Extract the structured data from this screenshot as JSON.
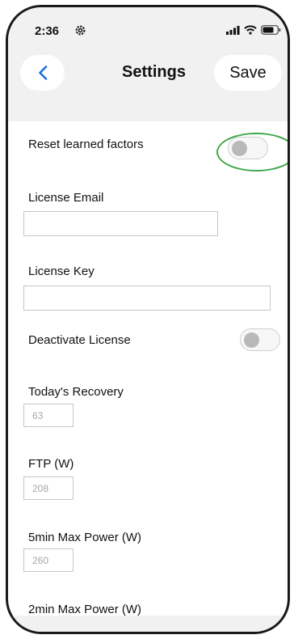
{
  "status_bar": {
    "time": "2:36",
    "icons": [
      "gear-icon",
      "signal-icon",
      "wifi-icon",
      "battery-icon"
    ]
  },
  "header": {
    "back_icon": "chevron-left-icon",
    "title": "Settings",
    "save_label": "Save"
  },
  "settings": {
    "reset_learned_factors": {
      "label": "Reset learned factors",
      "enabled": false
    },
    "license_email": {
      "label": "License Email",
      "value": ""
    },
    "license_key": {
      "label": "License Key",
      "value": ""
    },
    "deactivate_license": {
      "label": "Deactivate License",
      "enabled": false
    },
    "todays_recovery": {
      "label": "Today's Recovery",
      "placeholder": "63"
    },
    "ftp": {
      "label": "FTP (W)",
      "placeholder": "208"
    },
    "max_power_5min": {
      "label": "5min Max Power (W)",
      "placeholder": "260"
    },
    "max_power_2min": {
      "label": "2min Max Power (W)"
    }
  },
  "colors": {
    "header_bg": "#f1f1f2",
    "highlight_ring": "#3fa84a",
    "toggle_knob": "#b9b9b9"
  }
}
